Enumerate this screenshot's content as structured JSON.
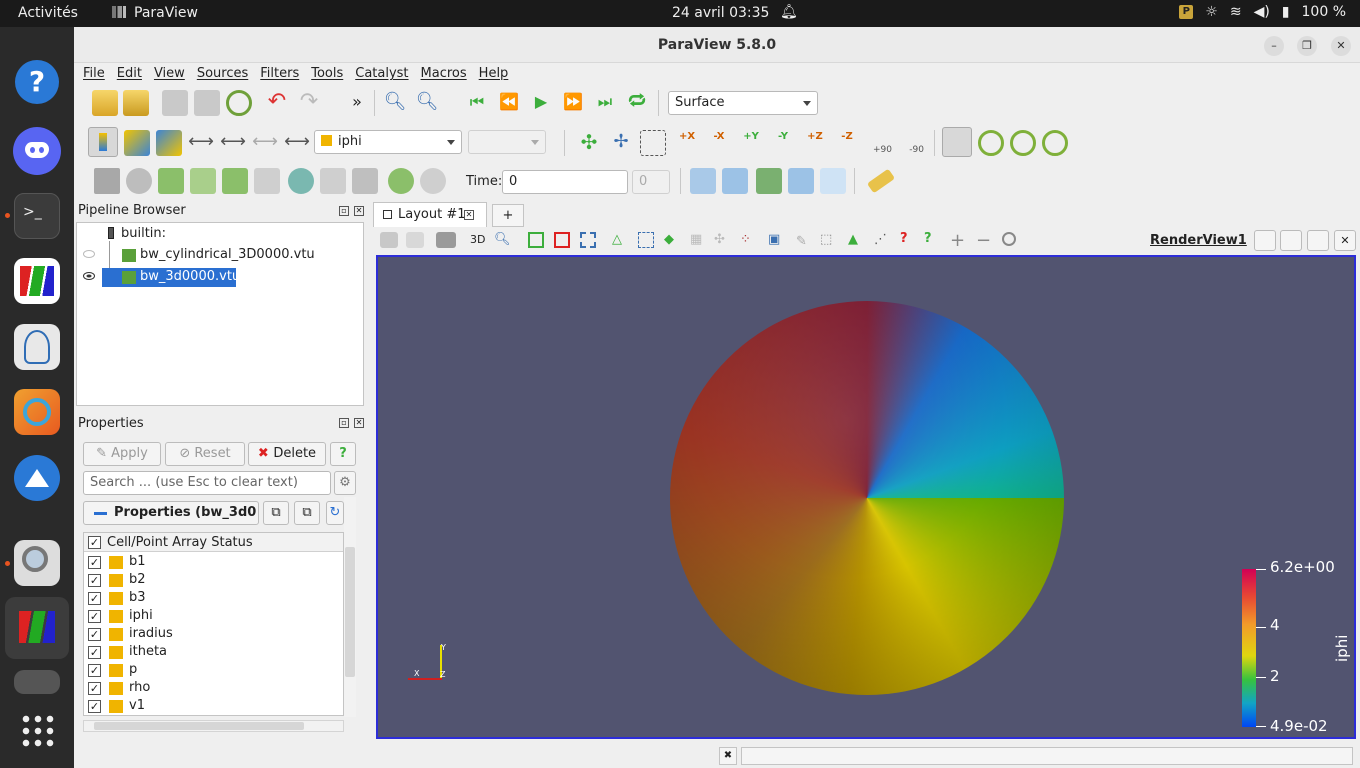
{
  "system": {
    "activities": "Activités",
    "app_name": "ParaView",
    "clock": "24 avril  03:35",
    "battery": "100 %"
  },
  "window": {
    "title": "ParaView 5.8.0"
  },
  "menu": [
    "File",
    "Edit",
    "View",
    "Sources",
    "Filters",
    "Tools",
    "Catalyst",
    "Macros",
    "Help"
  ],
  "toolbar": {
    "representation": "Surface",
    "color_array": "iphi",
    "time_label": "Time:",
    "time_value": "0",
    "time_index": "0",
    "rot_plus": "+90",
    "rot_minus": "-90",
    "axes": [
      "+X",
      "-X",
      "+Y",
      "-Y",
      "+Z",
      "-Z"
    ]
  },
  "pipeline": {
    "title": "Pipeline Browser",
    "root": "builtin:",
    "items": [
      {
        "label": "bw_cylindrical_3D0000.vtu",
        "selected": false
      },
      {
        "label": "bw_3d0000.vtu",
        "selected": true
      }
    ]
  },
  "properties": {
    "title": "Properties",
    "apply": "Apply",
    "reset": "Reset",
    "delete": "Delete",
    "help": "?",
    "search_placeholder": "Search ... (use Esc to clear text)",
    "section": "Properties (bw_3d0",
    "array_header": "Cell/Point Array Status",
    "arrays": [
      "b1",
      "b2",
      "b3",
      "iphi",
      "iradius",
      "itheta",
      "p",
      "rho",
      "v1"
    ]
  },
  "layout": {
    "tab": "Layout #1",
    "add_tab": "+",
    "view_name": "RenderView1",
    "btn_3d": "3D"
  },
  "render": {
    "colorbar_title": "iphi",
    "colorbar_labels": [
      "6.2e+00",
      "4",
      "2",
      "4.9e-02"
    ],
    "background": "#525470"
  },
  "axes_triad": {
    "x": "X",
    "y": "Y",
    "z": "Z"
  }
}
